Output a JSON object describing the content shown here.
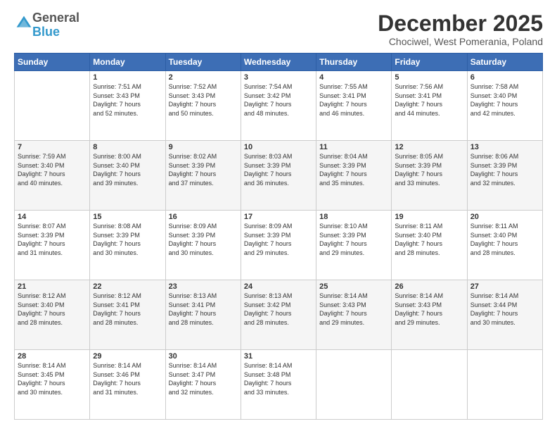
{
  "logo": {
    "general": "General",
    "blue": "Blue"
  },
  "header": {
    "month": "December 2025",
    "location": "Chociwel, West Pomerania, Poland"
  },
  "weekdays": [
    "Sunday",
    "Monday",
    "Tuesday",
    "Wednesday",
    "Thursday",
    "Friday",
    "Saturday"
  ],
  "weeks": [
    [
      {
        "day": "",
        "content": ""
      },
      {
        "day": "1",
        "content": "Sunrise: 7:51 AM\nSunset: 3:43 PM\nDaylight: 7 hours\nand 52 minutes."
      },
      {
        "day": "2",
        "content": "Sunrise: 7:52 AM\nSunset: 3:43 PM\nDaylight: 7 hours\nand 50 minutes."
      },
      {
        "day": "3",
        "content": "Sunrise: 7:54 AM\nSunset: 3:42 PM\nDaylight: 7 hours\nand 48 minutes."
      },
      {
        "day": "4",
        "content": "Sunrise: 7:55 AM\nSunset: 3:41 PM\nDaylight: 7 hours\nand 46 minutes."
      },
      {
        "day": "5",
        "content": "Sunrise: 7:56 AM\nSunset: 3:41 PM\nDaylight: 7 hours\nand 44 minutes."
      },
      {
        "day": "6",
        "content": "Sunrise: 7:58 AM\nSunset: 3:40 PM\nDaylight: 7 hours\nand 42 minutes."
      }
    ],
    [
      {
        "day": "7",
        "content": "Sunrise: 7:59 AM\nSunset: 3:40 PM\nDaylight: 7 hours\nand 40 minutes."
      },
      {
        "day": "8",
        "content": "Sunrise: 8:00 AM\nSunset: 3:40 PM\nDaylight: 7 hours\nand 39 minutes."
      },
      {
        "day": "9",
        "content": "Sunrise: 8:02 AM\nSunset: 3:39 PM\nDaylight: 7 hours\nand 37 minutes."
      },
      {
        "day": "10",
        "content": "Sunrise: 8:03 AM\nSunset: 3:39 PM\nDaylight: 7 hours\nand 36 minutes."
      },
      {
        "day": "11",
        "content": "Sunrise: 8:04 AM\nSunset: 3:39 PM\nDaylight: 7 hours\nand 35 minutes."
      },
      {
        "day": "12",
        "content": "Sunrise: 8:05 AM\nSunset: 3:39 PM\nDaylight: 7 hours\nand 33 minutes."
      },
      {
        "day": "13",
        "content": "Sunrise: 8:06 AM\nSunset: 3:39 PM\nDaylight: 7 hours\nand 32 minutes."
      }
    ],
    [
      {
        "day": "14",
        "content": "Sunrise: 8:07 AM\nSunset: 3:39 PM\nDaylight: 7 hours\nand 31 minutes."
      },
      {
        "day": "15",
        "content": "Sunrise: 8:08 AM\nSunset: 3:39 PM\nDaylight: 7 hours\nand 30 minutes."
      },
      {
        "day": "16",
        "content": "Sunrise: 8:09 AM\nSunset: 3:39 PM\nDaylight: 7 hours\nand 30 minutes."
      },
      {
        "day": "17",
        "content": "Sunrise: 8:09 AM\nSunset: 3:39 PM\nDaylight: 7 hours\nand 29 minutes."
      },
      {
        "day": "18",
        "content": "Sunrise: 8:10 AM\nSunset: 3:39 PM\nDaylight: 7 hours\nand 29 minutes."
      },
      {
        "day": "19",
        "content": "Sunrise: 8:11 AM\nSunset: 3:40 PM\nDaylight: 7 hours\nand 28 minutes."
      },
      {
        "day": "20",
        "content": "Sunrise: 8:11 AM\nSunset: 3:40 PM\nDaylight: 7 hours\nand 28 minutes."
      }
    ],
    [
      {
        "day": "21",
        "content": "Sunrise: 8:12 AM\nSunset: 3:40 PM\nDaylight: 7 hours\nand 28 minutes."
      },
      {
        "day": "22",
        "content": "Sunrise: 8:12 AM\nSunset: 3:41 PM\nDaylight: 7 hours\nand 28 minutes."
      },
      {
        "day": "23",
        "content": "Sunrise: 8:13 AM\nSunset: 3:41 PM\nDaylight: 7 hours\nand 28 minutes."
      },
      {
        "day": "24",
        "content": "Sunrise: 8:13 AM\nSunset: 3:42 PM\nDaylight: 7 hours\nand 28 minutes."
      },
      {
        "day": "25",
        "content": "Sunrise: 8:14 AM\nSunset: 3:43 PM\nDaylight: 7 hours\nand 29 minutes."
      },
      {
        "day": "26",
        "content": "Sunrise: 8:14 AM\nSunset: 3:43 PM\nDaylight: 7 hours\nand 29 minutes."
      },
      {
        "day": "27",
        "content": "Sunrise: 8:14 AM\nSunset: 3:44 PM\nDaylight: 7 hours\nand 30 minutes."
      }
    ],
    [
      {
        "day": "28",
        "content": "Sunrise: 8:14 AM\nSunset: 3:45 PM\nDaylight: 7 hours\nand 30 minutes."
      },
      {
        "day": "29",
        "content": "Sunrise: 8:14 AM\nSunset: 3:46 PM\nDaylight: 7 hours\nand 31 minutes."
      },
      {
        "day": "30",
        "content": "Sunrise: 8:14 AM\nSunset: 3:47 PM\nDaylight: 7 hours\nand 32 minutes."
      },
      {
        "day": "31",
        "content": "Sunrise: 8:14 AM\nSunset: 3:48 PM\nDaylight: 7 hours\nand 33 minutes."
      },
      {
        "day": "",
        "content": ""
      },
      {
        "day": "",
        "content": ""
      },
      {
        "day": "",
        "content": ""
      }
    ]
  ]
}
